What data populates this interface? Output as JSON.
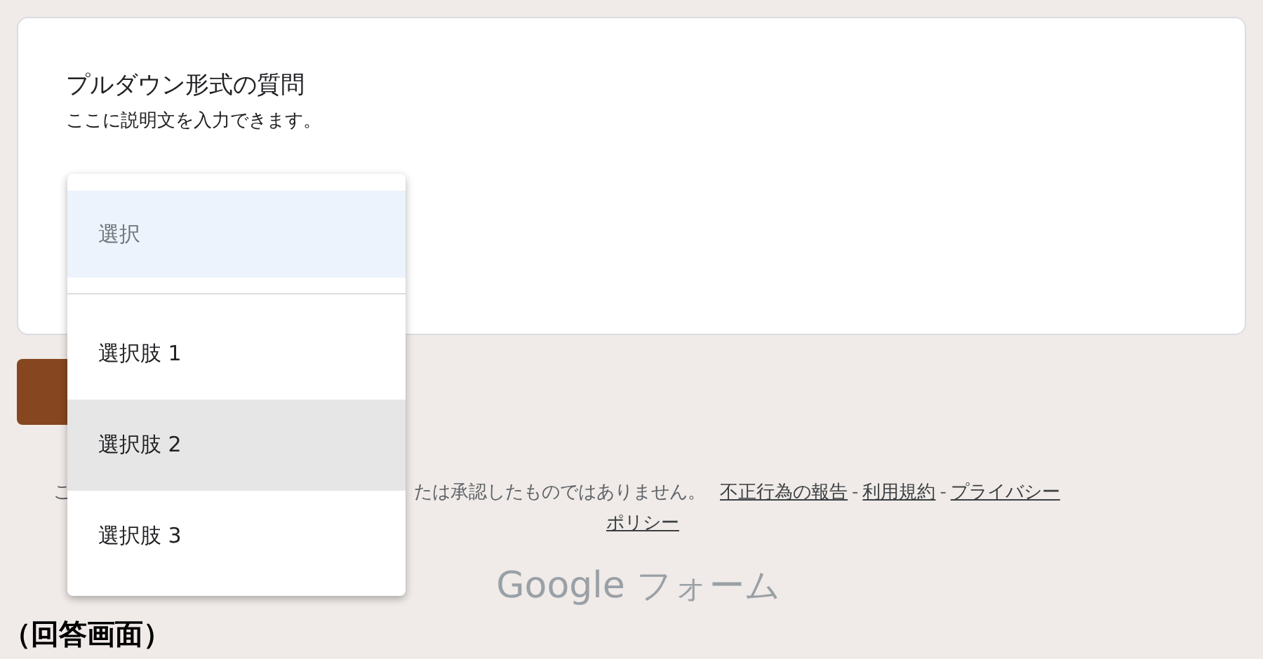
{
  "question": {
    "title": "プルダウン形式の質問",
    "description": "ここに説明文を入力できます。"
  },
  "dropdown": {
    "options": [
      {
        "label": "選択",
        "kind": "placeholder",
        "selected": true,
        "highlighted": false
      },
      {
        "label": "選択肢 1",
        "kind": "option",
        "selected": false,
        "highlighted": false
      },
      {
        "label": "選択肢 2",
        "kind": "option",
        "selected": false,
        "highlighted": true
      },
      {
        "label": "選択肢 3",
        "kind": "option",
        "selected": false,
        "highlighted": false
      }
    ]
  },
  "footer": {
    "line_1": [
      {
        "kind": "text",
        "text": "こ"
      },
      {
        "kind": "text",
        "text": "たは承認したものではありません。"
      },
      {
        "kind": "link",
        "text": "不正行為の報告"
      },
      {
        "kind": "separator",
        "text": "-"
      },
      {
        "kind": "link",
        "text": "利用規約"
      },
      {
        "kind": "separator",
        "text": "-"
      },
      {
        "kind": "link",
        "text": "プライバシー"
      }
    ],
    "line_2": [
      {
        "kind": "link",
        "text": "ポリシー"
      }
    ]
  },
  "brand": {
    "logo": "Google",
    "product": "フォーム"
  },
  "caption": "（回答画面）"
}
